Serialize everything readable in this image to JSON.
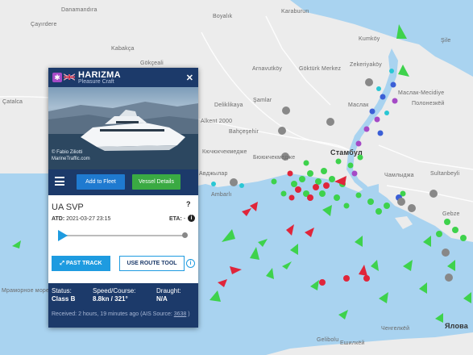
{
  "map": {
    "labels": [
      "Danamandıra",
      "Çayırdere",
      "Kabakça",
      "Gökçeali",
      "Boyalık",
      "Karaburun",
      "Arnavutköy",
      "Göktürk Merkez",
      "Deliklikaya",
      "Şamlar",
      "Alkent 2000",
      "Bahçeşehir",
      "Çatalca",
      "Мраморное море",
      "Ченгелкёй",
      "Ешилкёй",
      "Авджылар",
      "Ambarlı",
      "Şile",
      "Kumköy",
      "Zekeriyaköy",
      "Маслак",
      "Чамлыджа",
      "Ялова",
      "Gelibolu",
      "Кючюкчекмедже",
      "Бююкчекмедже",
      "Sultanbeyli",
      "Gebze",
      "Стамбул",
      "Полонезкёй",
      "Маслак-Mecidiye"
    ]
  },
  "popup": {
    "vessel_name": "HARIZMA",
    "vessel_type": "Pleasure Craft",
    "flag": "GB",
    "photo_credit_line1": "© Fabio Ziliotti",
    "photo_credit_line2": "MarineTraffic.com",
    "actions": {
      "add_to_fleet": "Add to Fleet",
      "vessel_details": "Vessel Details"
    },
    "route": {
      "name": "UA SVP",
      "atd_label": "ATD:",
      "atd_value": "2021-03-27 23:15",
      "eta_label": "ETA:",
      "eta_value": "-"
    },
    "buttons": {
      "past_track": "PAST TRACK",
      "use_route_tool": "USE ROUTE TOOL"
    },
    "stats": {
      "status_label": "Status:",
      "status_value": "Class B",
      "speed_label": "Speed/Course:",
      "speed_value": "8.8kn / 321°",
      "draught_label": "Draught:",
      "draught_value": "N/A"
    },
    "received_text": "Received: 2 hours, 19 minutes ago (AIS Source: ",
    "received_source": "3638",
    "received_tail": " )"
  },
  "colors": {
    "land": "#ececec",
    "sea": "#a9d3f0",
    "popup_header": "#1c3a6a",
    "button_blue": "#1f7ad0",
    "button_green": "#3aaa43",
    "accent_cyan": "#1e9be0"
  }
}
